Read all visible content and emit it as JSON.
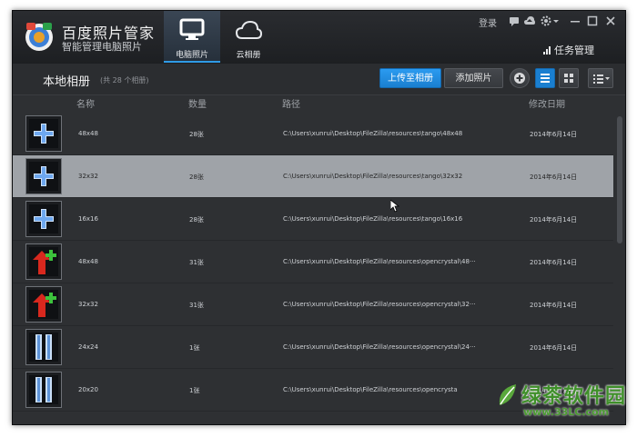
{
  "app": {
    "title": "百度照片管家",
    "subtitle": "智能管理电脑照片",
    "logo_icon": "baidu-photo-logo"
  },
  "nav": {
    "tabs": [
      {
        "label": "电脑照片",
        "icon": "monitor-icon",
        "active": true
      },
      {
        "label": "云相册",
        "icon": "cloud-icon",
        "active": false
      }
    ]
  },
  "top_bar": {
    "login_label": "登录",
    "task_manager_label": "任务管理",
    "icons": [
      "message-icon",
      "cloud-upload-icon",
      "gear-icon",
      "minimize-icon",
      "maximize-icon",
      "close-icon"
    ]
  },
  "toolbar": {
    "album_title": "本地相册",
    "album_count": "(共 28 个相册)",
    "upload_label": "上传至相册",
    "add_label": "添加照片"
  },
  "columns": {
    "name": "名称",
    "count": "数量",
    "path": "路径",
    "date": "修改日期"
  },
  "rows": [
    {
      "name": "48x48",
      "count": "28张",
      "path": "C:\\Users\\xunrui\\Desktop\\FileZilla\\resources\\tango\\48x48",
      "date": "2014年6月14日",
      "thumb": "plus",
      "selected": false
    },
    {
      "name": "32x32",
      "count": "28张",
      "path": "C:\\Users\\xunrui\\Desktop\\FileZilla\\resources\\tango\\32x32",
      "date": "2014年6月14日",
      "thumb": "plus",
      "selected": true
    },
    {
      "name": "16x16",
      "count": "28张",
      "path": "C:\\Users\\xunrui\\Desktop\\FileZilla\\resources\\tango\\16x16",
      "date": "2014年6月14日",
      "thumb": "plus",
      "selected": false
    },
    {
      "name": "48x48",
      "count": "31张",
      "path": "C:\\Users\\xunrui\\Desktop\\FileZilla\\resources\\opencrystal\\48···",
      "date": "2014年6月14日",
      "thumb": "arrow",
      "selected": false
    },
    {
      "name": "32x32",
      "count": "31张",
      "path": "C:\\Users\\xunrui\\Desktop\\FileZilla\\resources\\opencrystal\\32···",
      "date": "2014年6月14日",
      "thumb": "arrow",
      "selected": false
    },
    {
      "name": "24x24",
      "count": "1张",
      "path": "C:\\Users\\xunrui\\Desktop\\FileZilla\\resources\\opencrystal\\24···",
      "date": "2014年6月14日",
      "thumb": "pause",
      "selected": false
    },
    {
      "name": "20x20",
      "count": "1张",
      "path": "C:\\Users\\xunrui\\Desktop\\FileZilla\\resources\\opencrysta",
      "date": "2014年6月14日",
      "thumb": "pause",
      "selected": false
    }
  ],
  "watermark": {
    "brand": "绿茶软件园",
    "url": "www.33LC.com"
  },
  "colors": {
    "accent": "#2b9bf0",
    "selected_row": "#9fa3a8",
    "background": "#2e3033"
  }
}
